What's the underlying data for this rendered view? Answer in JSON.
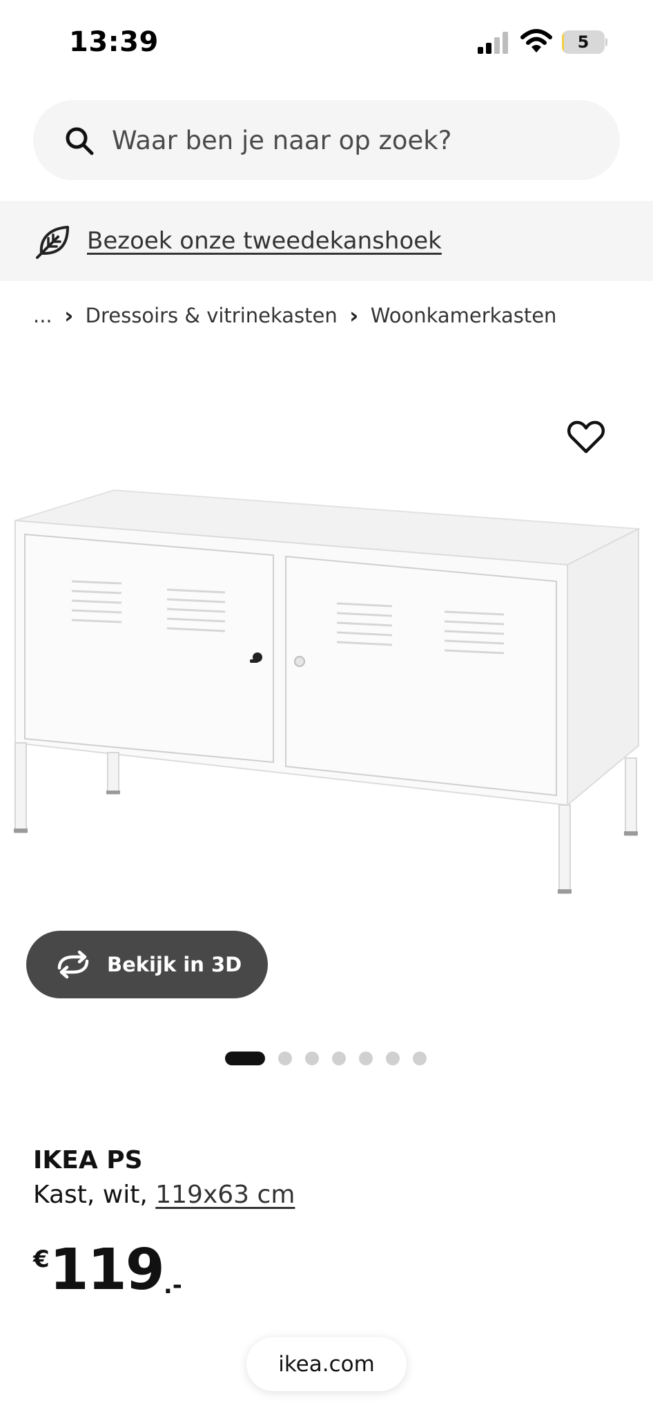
{
  "status_bar": {
    "time": "13:39",
    "battery_level": "5",
    "battery_percent": 5,
    "battery_color": "#f4cf43",
    "icons": [
      "signal-icon",
      "wifi-icon",
      "battery-icon"
    ]
  },
  "search": {
    "placeholder": "Waar ben je naar op zoek?",
    "icon": "search-icon"
  },
  "banner": {
    "icon": "leaf-icon",
    "link_text": "Bezoek onze tweedekanshoek"
  },
  "breadcrumb": {
    "items": [
      "...",
      "Dressoirs & vitrinekasten",
      "Woonkamerkasten"
    ],
    "separator": "›"
  },
  "gallery": {
    "favorite_icon": "heart-icon",
    "view_3d_label": "Bekijk in 3D",
    "view_3d_icon": "rotate-3d-icon",
    "total_images": 7,
    "active_index": 0
  },
  "product": {
    "name": "IKEA PS",
    "description_prefix": "Kast, wit, ",
    "size": "119x63 cm",
    "price": {
      "currency": "€",
      "amount": "119",
      "suffix": ".-"
    }
  },
  "browser": {
    "url": "ikea.com"
  },
  "colors": {
    "button_dark": "#484848",
    "surface_gray": "#f5f5f5",
    "dot_active": "#111111",
    "dot_inactive": "#d0d0d0"
  }
}
